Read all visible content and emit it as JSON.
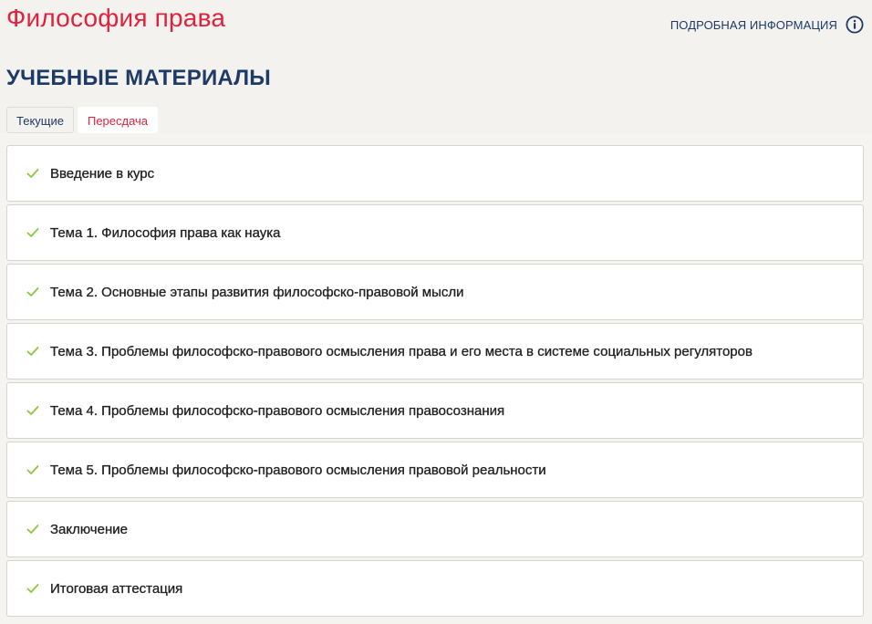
{
  "course": {
    "title": "Философия права"
  },
  "header": {
    "info_link_label": "ПОДРОБНАЯ ИНФОРМАЦИЯ",
    "info_icon": "info-circle-icon"
  },
  "materials": {
    "section_title": "УЧЕБНЫЕ МАТЕРИАЛЫ",
    "tabs": [
      {
        "label": "Текущие",
        "active": false
      },
      {
        "label": "Пересдача",
        "active": true
      }
    ],
    "modules": [
      {
        "label": "Введение в курс",
        "completed": true,
        "icon": "check-icon"
      },
      {
        "label": "Тема 1. Философия права как наука",
        "completed": true,
        "icon": "check-icon"
      },
      {
        "label": "Тема 2. Основные этапы развития философско-правовой мысли",
        "completed": true,
        "icon": "check-icon"
      },
      {
        "label": "Тема 3. Проблемы философско-правового осмысления права и его места в системе социальных регуляторов",
        "completed": true,
        "icon": "check-icon"
      },
      {
        "label": "Тема 4. Проблемы философско-правового осмысления правосознания",
        "completed": true,
        "icon": "check-icon"
      },
      {
        "label": "Тема 5. Проблемы философско-правового осмысления правовой реальности",
        "completed": true,
        "icon": "check-icon"
      },
      {
        "label": "Заключение",
        "completed": true,
        "icon": "check-icon"
      },
      {
        "label": "Итоговая аттестация",
        "completed": true,
        "icon": "check-icon"
      }
    ]
  },
  "colors": {
    "title_red": "#e0223e",
    "navy": "#1e3a66",
    "check_green": "#8cc63f",
    "background": "#f3f2ee"
  }
}
